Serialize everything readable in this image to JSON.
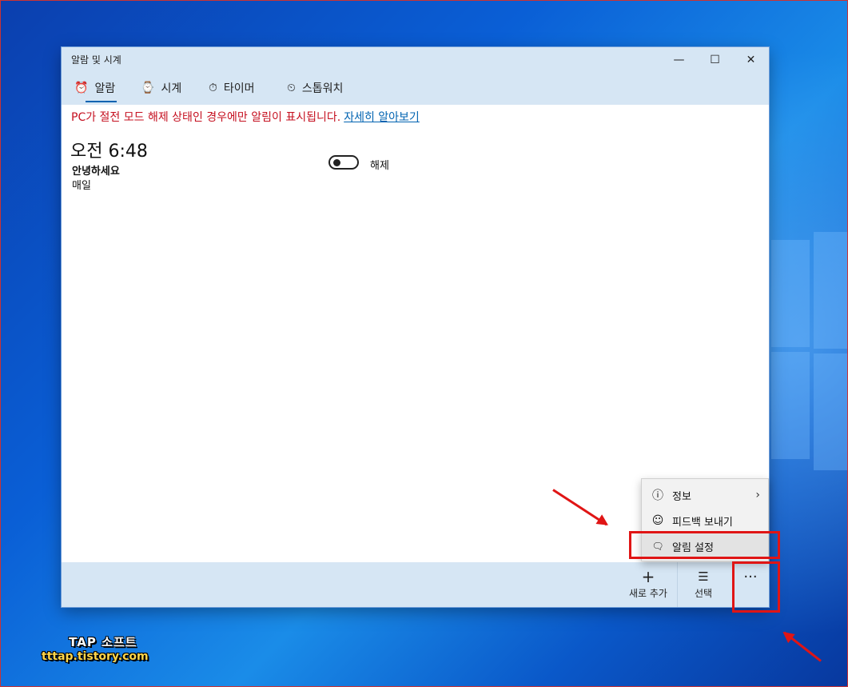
{
  "window": {
    "title": "알람 및 시계"
  },
  "titlebar": {
    "minimize": "—",
    "maximize": "☐",
    "close": "✕"
  },
  "tabs": [
    {
      "label": "알람",
      "icon": "alarm-clock-icon",
      "glyph": "⏰",
      "active": true
    },
    {
      "label": "시계",
      "icon": "world-clock-icon",
      "glyph": "⌚",
      "active": false
    },
    {
      "label": "타이머",
      "icon": "timer-icon",
      "glyph": "⏱",
      "active": false
    },
    {
      "label": "스톱워치",
      "icon": "stopwatch-icon",
      "glyph": "⏲",
      "active": false
    }
  ],
  "notice": {
    "text": "PC가 절전 모드 해제 상태인 경우에만 알림이 표시됩니다.",
    "link": "자세히 알아보기"
  },
  "alarm": {
    "time": "오전 6:48",
    "name": "안녕하세요",
    "repeat": "매일",
    "toggle_label": "해제"
  },
  "commands": {
    "add": {
      "label": "새로 추가",
      "glyph": "+"
    },
    "select": {
      "label": "선택",
      "glyph": "☰"
    },
    "more": {
      "glyph": "···"
    }
  },
  "menu": {
    "items": [
      {
        "label": "정보",
        "glyph": "ⓘ",
        "icon": "info-icon"
      },
      {
        "label": "피드백 보내기",
        "glyph": "☺",
        "icon": "feedback-icon"
      },
      {
        "label": "알림 설정",
        "glyph": "🗨",
        "icon": "notification-icon"
      }
    ],
    "chevron": "›"
  },
  "watermark": {
    "line1": "TAP 소프트",
    "line2": "tttap.tistory.com"
  },
  "colors": {
    "accent": "#0063b1",
    "warning": "#c50f1f",
    "annotation": "#e01515",
    "bar": "#d6e6f4"
  }
}
